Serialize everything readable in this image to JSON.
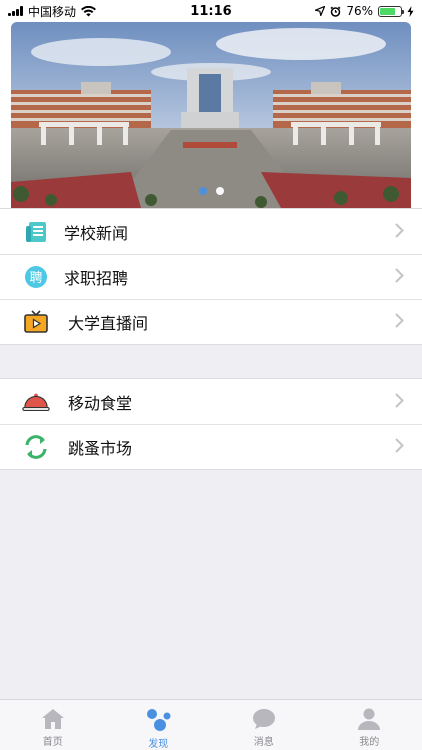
{
  "status_bar": {
    "carrier": "中国移动",
    "time": "11:16",
    "battery_pct": "76%",
    "battery_level": 0.76
  },
  "banner": {
    "slide_count": 2,
    "active_slide": 1
  },
  "menu_group_1": [
    {
      "label": "学校新闻",
      "icon": "newspaper-icon"
    },
    {
      "label": "求职招聘",
      "icon": "recruit-icon",
      "icon_text": "聘"
    },
    {
      "label": "大学直播间",
      "icon": "tv-live-icon"
    }
  ],
  "menu_group_2": [
    {
      "label": "移动食堂",
      "icon": "food-cloche-icon"
    },
    {
      "label": "跳蚤市场",
      "icon": "exchange-arrows-icon"
    }
  ],
  "tabbar": {
    "tabs": [
      {
        "label": "首页",
        "icon": "home-icon"
      },
      {
        "label": "发现",
        "icon": "discover-icon"
      },
      {
        "label": "消息",
        "icon": "chat-bubble-icon"
      },
      {
        "label": "我的",
        "icon": "person-icon"
      }
    ],
    "active": "发现"
  },
  "colors": {
    "accent": "#4a90e2",
    "inactive": "#b7b7bd",
    "background": "#eeeef3"
  }
}
